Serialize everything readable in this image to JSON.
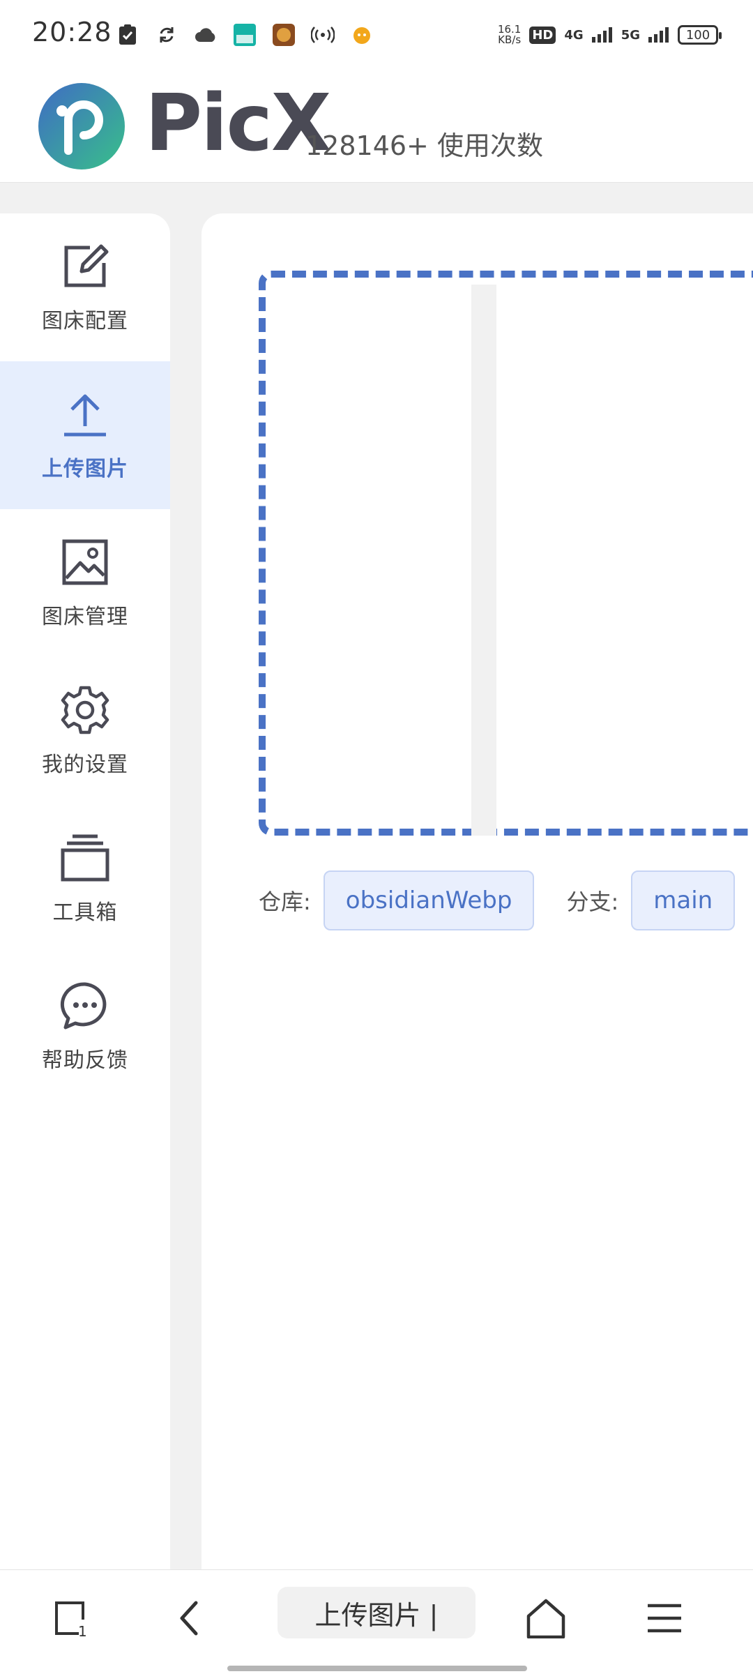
{
  "status_bar": {
    "time": "20:28",
    "network_speed": "16.1",
    "network_speed_unit": "KB/s",
    "hd_badge": "HD",
    "signal_4g": "4G",
    "signal_5g": "5G",
    "battery": "100"
  },
  "header": {
    "brand": "PicX",
    "usage": "128146+ 使用次数"
  },
  "sidebar": {
    "items": [
      {
        "label": "图床配置",
        "icon": "edit-icon"
      },
      {
        "label": "上传图片",
        "icon": "upload-icon",
        "active": true
      },
      {
        "label": "图床管理",
        "icon": "image-icon"
      },
      {
        "label": "我的设置",
        "icon": "gear-icon"
      },
      {
        "label": "工具箱",
        "icon": "toolbox-icon"
      },
      {
        "label": "帮助反馈",
        "icon": "chat-icon"
      }
    ]
  },
  "main": {
    "repo_label": "仓库:",
    "repo_value": "obsidianWebp",
    "branch_label": "分支:",
    "branch_value": "main"
  },
  "bottom_nav": {
    "tab_count": "1",
    "address_text": "上传图片 |"
  },
  "colors": {
    "accent": "#4a72c5",
    "active_bg": "#e6eefd",
    "page_bg": "#f1f1f1"
  }
}
